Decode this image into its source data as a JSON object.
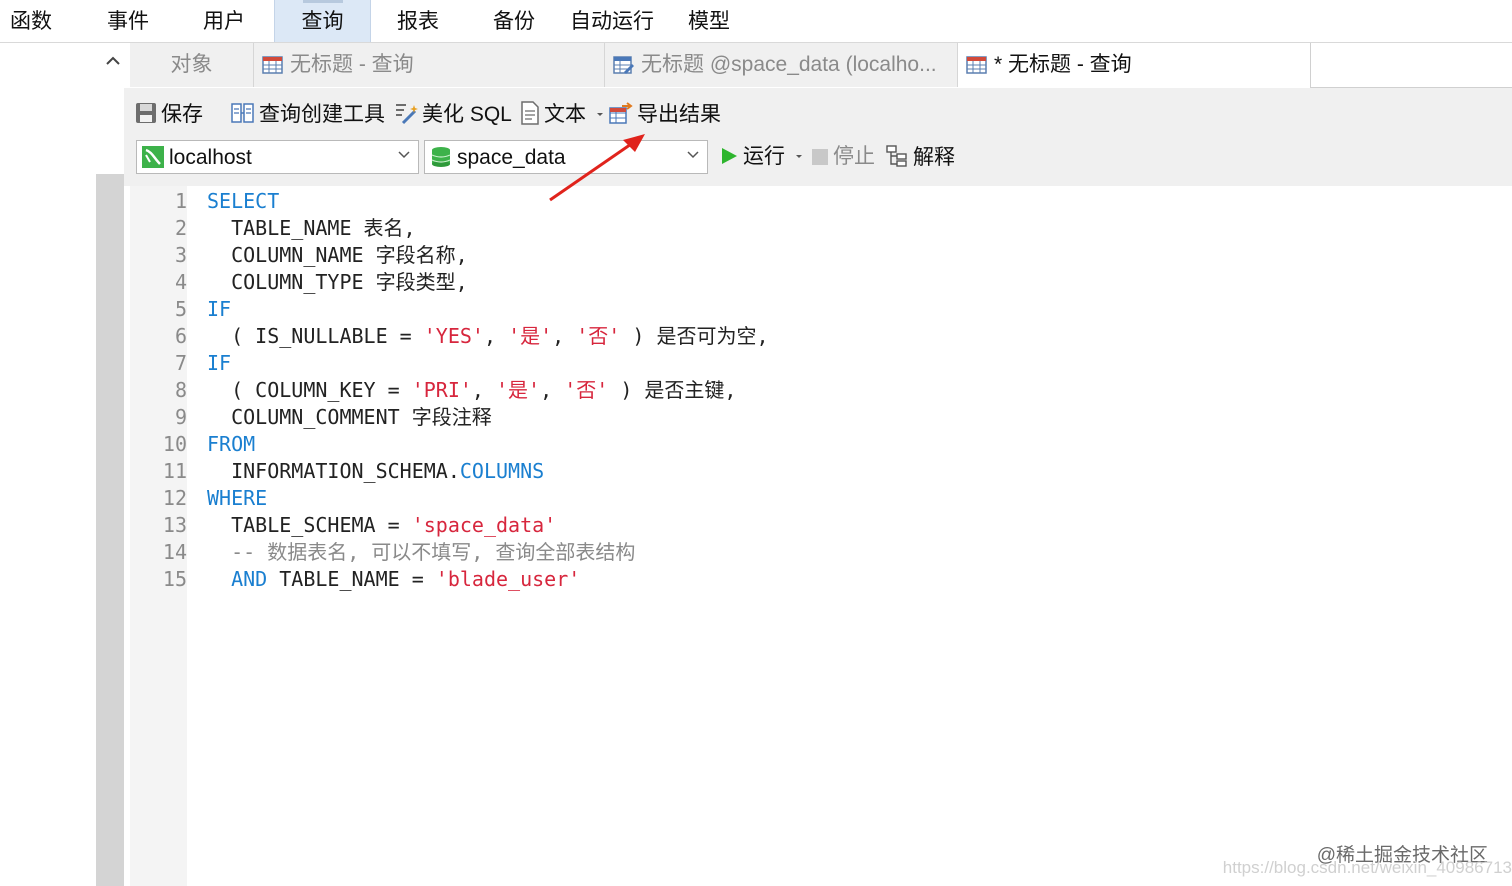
{
  "menu": {
    "items": [
      "函数",
      "事件",
      "用户",
      "查询",
      "报表",
      "备份",
      "自动运行",
      "模型"
    ],
    "active": "查询"
  },
  "tabs": [
    {
      "label": "对象",
      "active": false
    },
    {
      "label": "无标题 - 查询",
      "active": false
    },
    {
      "label": "无标题 @space_data (localho...",
      "active": false
    },
    {
      "label": "* 无标题 - 查询",
      "active": true
    }
  ],
  "toolbar": {
    "save": "保存",
    "query_builder": "查询创建工具",
    "beautify": "美化 SQL",
    "text": "文本",
    "export": "导出结果",
    "run": "运行",
    "stop": "停止",
    "explain": "解释"
  },
  "connection": {
    "value": "localhost"
  },
  "database": {
    "value": "space_data"
  },
  "editor": {
    "line_numbers": [
      "1",
      "2",
      "3",
      "4",
      "5",
      "6",
      "7",
      "8",
      "9",
      "10",
      "11",
      "12",
      "13",
      "14",
      "15"
    ],
    "lines": [
      [
        {
          "t": "SELECT",
          "c": "kw"
        }
      ],
      [
        {
          "t": "  TABLE_NAME 表名,",
          "c": ""
        }
      ],
      [
        {
          "t": "  COLUMN_NAME 字段名称,",
          "c": ""
        }
      ],
      [
        {
          "t": "  COLUMN_TYPE 字段类型,",
          "c": ""
        }
      ],
      [
        {
          "t": "IF",
          "c": "kw"
        }
      ],
      [
        {
          "t": "  ( IS_NULLABLE = ",
          "c": ""
        },
        {
          "t": "'YES'",
          "c": "str"
        },
        {
          "t": ", ",
          "c": ""
        },
        {
          "t": "'是'",
          "c": "str"
        },
        {
          "t": ", ",
          "c": ""
        },
        {
          "t": "'否'",
          "c": "str"
        },
        {
          "t": " ) 是否可为空,",
          "c": ""
        }
      ],
      [
        {
          "t": "IF",
          "c": "kw"
        }
      ],
      [
        {
          "t": "  ( COLUMN_KEY = ",
          "c": ""
        },
        {
          "t": "'PRI'",
          "c": "str"
        },
        {
          "t": ", ",
          "c": ""
        },
        {
          "t": "'是'",
          "c": "str"
        },
        {
          "t": ", ",
          "c": ""
        },
        {
          "t": "'否'",
          "c": "str"
        },
        {
          "t": " ) 是否主键,",
          "c": ""
        }
      ],
      [
        {
          "t": "  COLUMN_COMMENT 字段注释",
          "c": ""
        }
      ],
      [
        {
          "t": "FROM",
          "c": "kw"
        }
      ],
      [
        {
          "t": "  INFORMATION_SCHEMA.",
          "c": ""
        },
        {
          "t": "COLUMNS",
          "c": "kw"
        }
      ],
      [
        {
          "t": "WHERE",
          "c": "kw"
        }
      ],
      [
        {
          "t": "  TABLE_SCHEMA = ",
          "c": ""
        },
        {
          "t": "'space_data'",
          "c": "str"
        }
      ],
      [
        {
          "t": "  -- 数据表名, 可以不填写, 查询全部表结构",
          "c": "cm"
        }
      ],
      [
        {
          "t": "  ",
          "c": ""
        },
        {
          "t": "AND",
          "c": "kw"
        },
        {
          "t": " TABLE_NAME = ",
          "c": ""
        },
        {
          "t": "'blade_user'",
          "c": "str"
        }
      ]
    ]
  },
  "watermark": {
    "line1": "@稀土掘金技术社区",
    "line2": "https://blog.csdn.net/weixin_40986713"
  },
  "colors": {
    "keyword": "#1a7fd0",
    "string": "#d7263d",
    "comment": "#8a8a8a",
    "annotation_arrow": "#e0231c",
    "run_green": "#2db52d"
  }
}
